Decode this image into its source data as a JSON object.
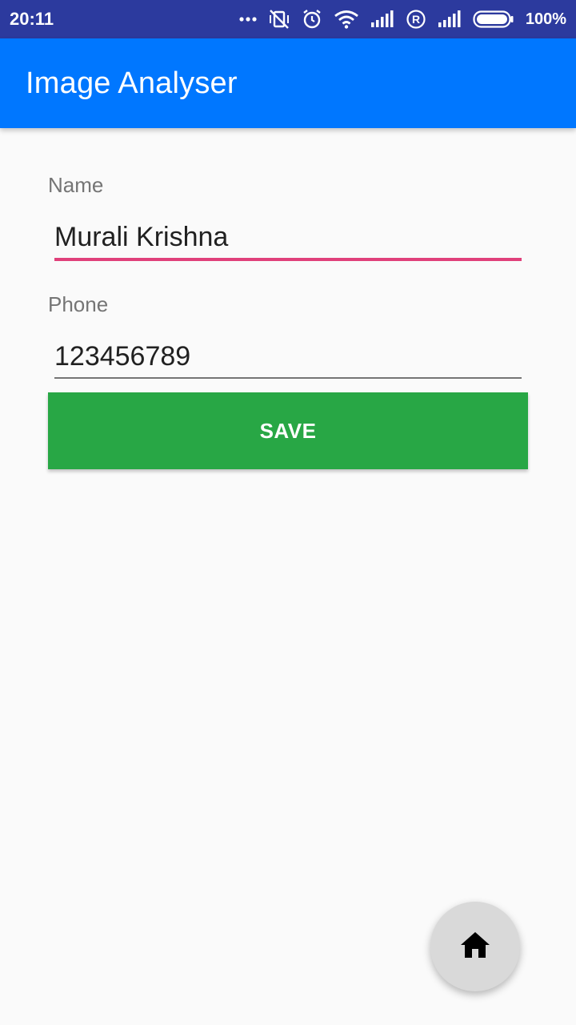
{
  "status_bar": {
    "time": "20:11",
    "battery_percent": "100%",
    "icons": [
      "more-dots-icon",
      "vibrate-off-icon",
      "alarm-icon",
      "wifi-icon",
      "signal-icon",
      "roaming-icon",
      "signal-icon",
      "battery-icon"
    ]
  },
  "app_bar": {
    "title": "Image Analyser",
    "color": "#0077ff"
  },
  "form": {
    "name": {
      "label": "Name",
      "value": "Murali Krishna",
      "underline_color": "#e0407a"
    },
    "phone": {
      "label": "Phone",
      "value": "123456789"
    },
    "save_label": "SAVE",
    "save_color": "#28a745"
  },
  "fab": {
    "icon": "home-icon"
  }
}
